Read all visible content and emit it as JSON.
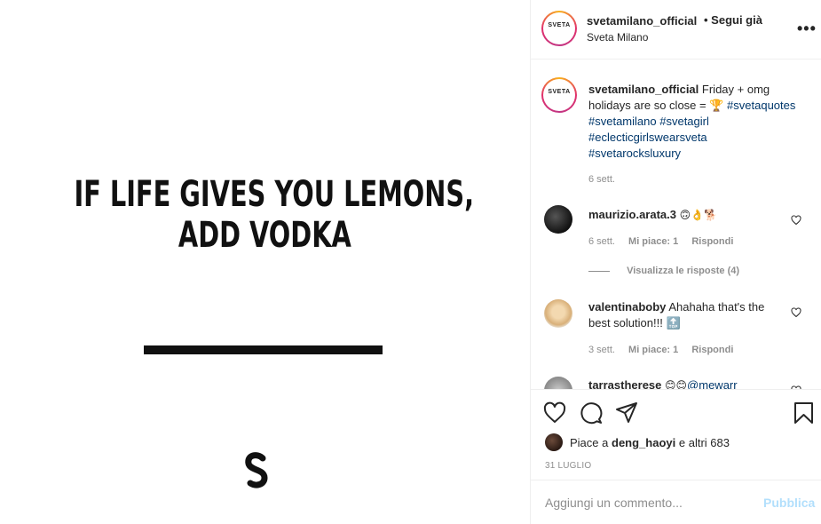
{
  "image": {
    "quote_line1": "IF LIFE GIVES YOU LEMONS,",
    "quote_line2": "ADD VODKA"
  },
  "header": {
    "avatar_logo": "SVETA",
    "username": "svetamilano_official",
    "follow_status": "• Segui già",
    "location": "Sveta Milano",
    "more_icon": "ellipsis-icon"
  },
  "caption": {
    "avatar_logo": "SVETA",
    "username": "svetamilano_official",
    "text": "Friday + omg holidays are so close = 🏆",
    "hashtags": [
      "#svetaquotes",
      "#svetamilano",
      "#svetagirl",
      "#eclecticgirlswearsveta",
      "#svetarocksluxury"
    ],
    "time": "6 sett."
  },
  "comments": [
    {
      "username": "maurizio.arata.3",
      "text": "🙃👌🐕",
      "time": "6 sett.",
      "likes": "Mi piace: 1",
      "reply": "Rispondi",
      "view_replies": "Visualizza le risposte (4)"
    },
    {
      "username": "valentinaboby",
      "text": "Ahahaha that's the best solution!!! 🔝",
      "time": "3 sett.",
      "likes": "Mi piace: 1",
      "reply": "Rispondi"
    },
    {
      "username": "tarrastherese",
      "text": "😊😊",
      "mention": "@mewarr"
    }
  ],
  "actions": {
    "like_icon": "heart-icon",
    "comment_icon": "comment-bubble-icon",
    "share_icon": "paper-plane-icon",
    "save_icon": "bookmark-icon"
  },
  "likes": {
    "prefix": "Piace a",
    "user": "deng_haoyi",
    "suffix": "e altri 683"
  },
  "post_date": "31 LUGLIO",
  "add_comment": {
    "placeholder": "Aggiungi un commento...",
    "publish_label": "Pubblica"
  },
  "colors": {
    "link": "#00376b",
    "muted": "#8e8e8e",
    "publish_disabled": "#b2dffc"
  }
}
